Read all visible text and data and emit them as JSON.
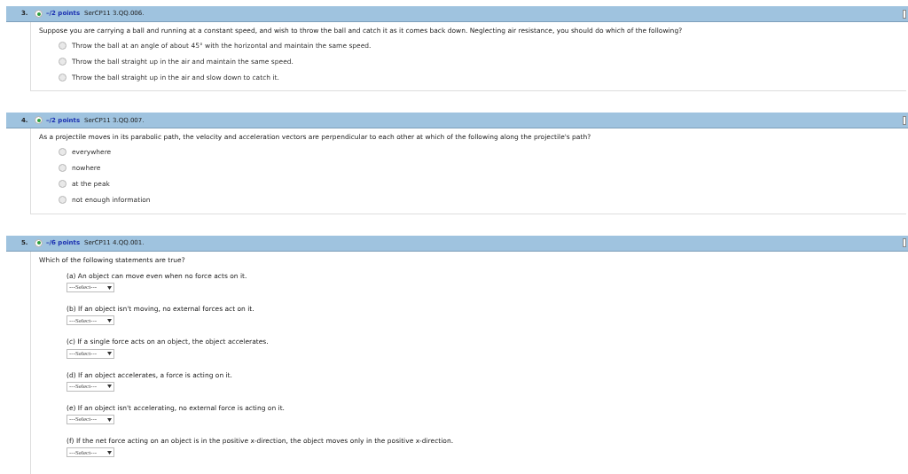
{
  "questions": [
    {
      "number": "3.",
      "points": "–/2 points",
      "code": "SerCP11 3.QQ.006.",
      "prompt": "Suppose you are carrying a ball and running at a constant speed, and wish to throw the ball and catch it as it comes back down. Neglecting air resistance, you should do which of the following?",
      "kind": "radio",
      "options": [
        {
          "label": "Throw the ball at an angle of about 45° with the horizontal and maintain the same speed.",
          "selected": false
        },
        {
          "label": "Throw the ball straight up in the air and maintain the same speed.",
          "selected": false
        },
        {
          "label": "Throw the ball straight up in the air and slow down to catch it.",
          "selected": false
        }
      ]
    },
    {
      "number": "4.",
      "points": "–/2 points",
      "code": "SerCP11 3.QQ.007.",
      "prompt": "As a projectile moves in its parabolic path, the velocity and acceleration vectors are perpendicular to each other at which of the following along the projectile's path?",
      "kind": "radio",
      "options": [
        {
          "label": "everywhere",
          "selected": false
        },
        {
          "label": "nowhere",
          "selected": false
        },
        {
          "label": "at the peak",
          "selected": false
        },
        {
          "label": "not enough information",
          "selected": false
        }
      ]
    },
    {
      "number": "5.",
      "points": "–/6 points",
      "code": "SerCP11 4.QQ.001.",
      "prompt": "Which of the following statements are true?",
      "kind": "select",
      "parts": [
        {
          "label": "(a) An object can move even when no force acts on it.",
          "value": "---Select---"
        },
        {
          "label": "(b) If an object isn't moving, no external forces act on it.",
          "value": "---Select---"
        },
        {
          "label": "(c) If a single force acts on an object, the object accelerates.",
          "value": "---Select---"
        },
        {
          "label": "(d) If an object accelerates, a force is acting on it.",
          "value": "---Select---"
        },
        {
          "label": "(e) If an object isn't accelerating, no external force is acting on it.",
          "value": "---Select---"
        },
        {
          "label": "(f) If the net force acting on an object is in the positive x-direction, the object moves only in the positive x-direction.",
          "value": "---Select---"
        }
      ]
    }
  ]
}
